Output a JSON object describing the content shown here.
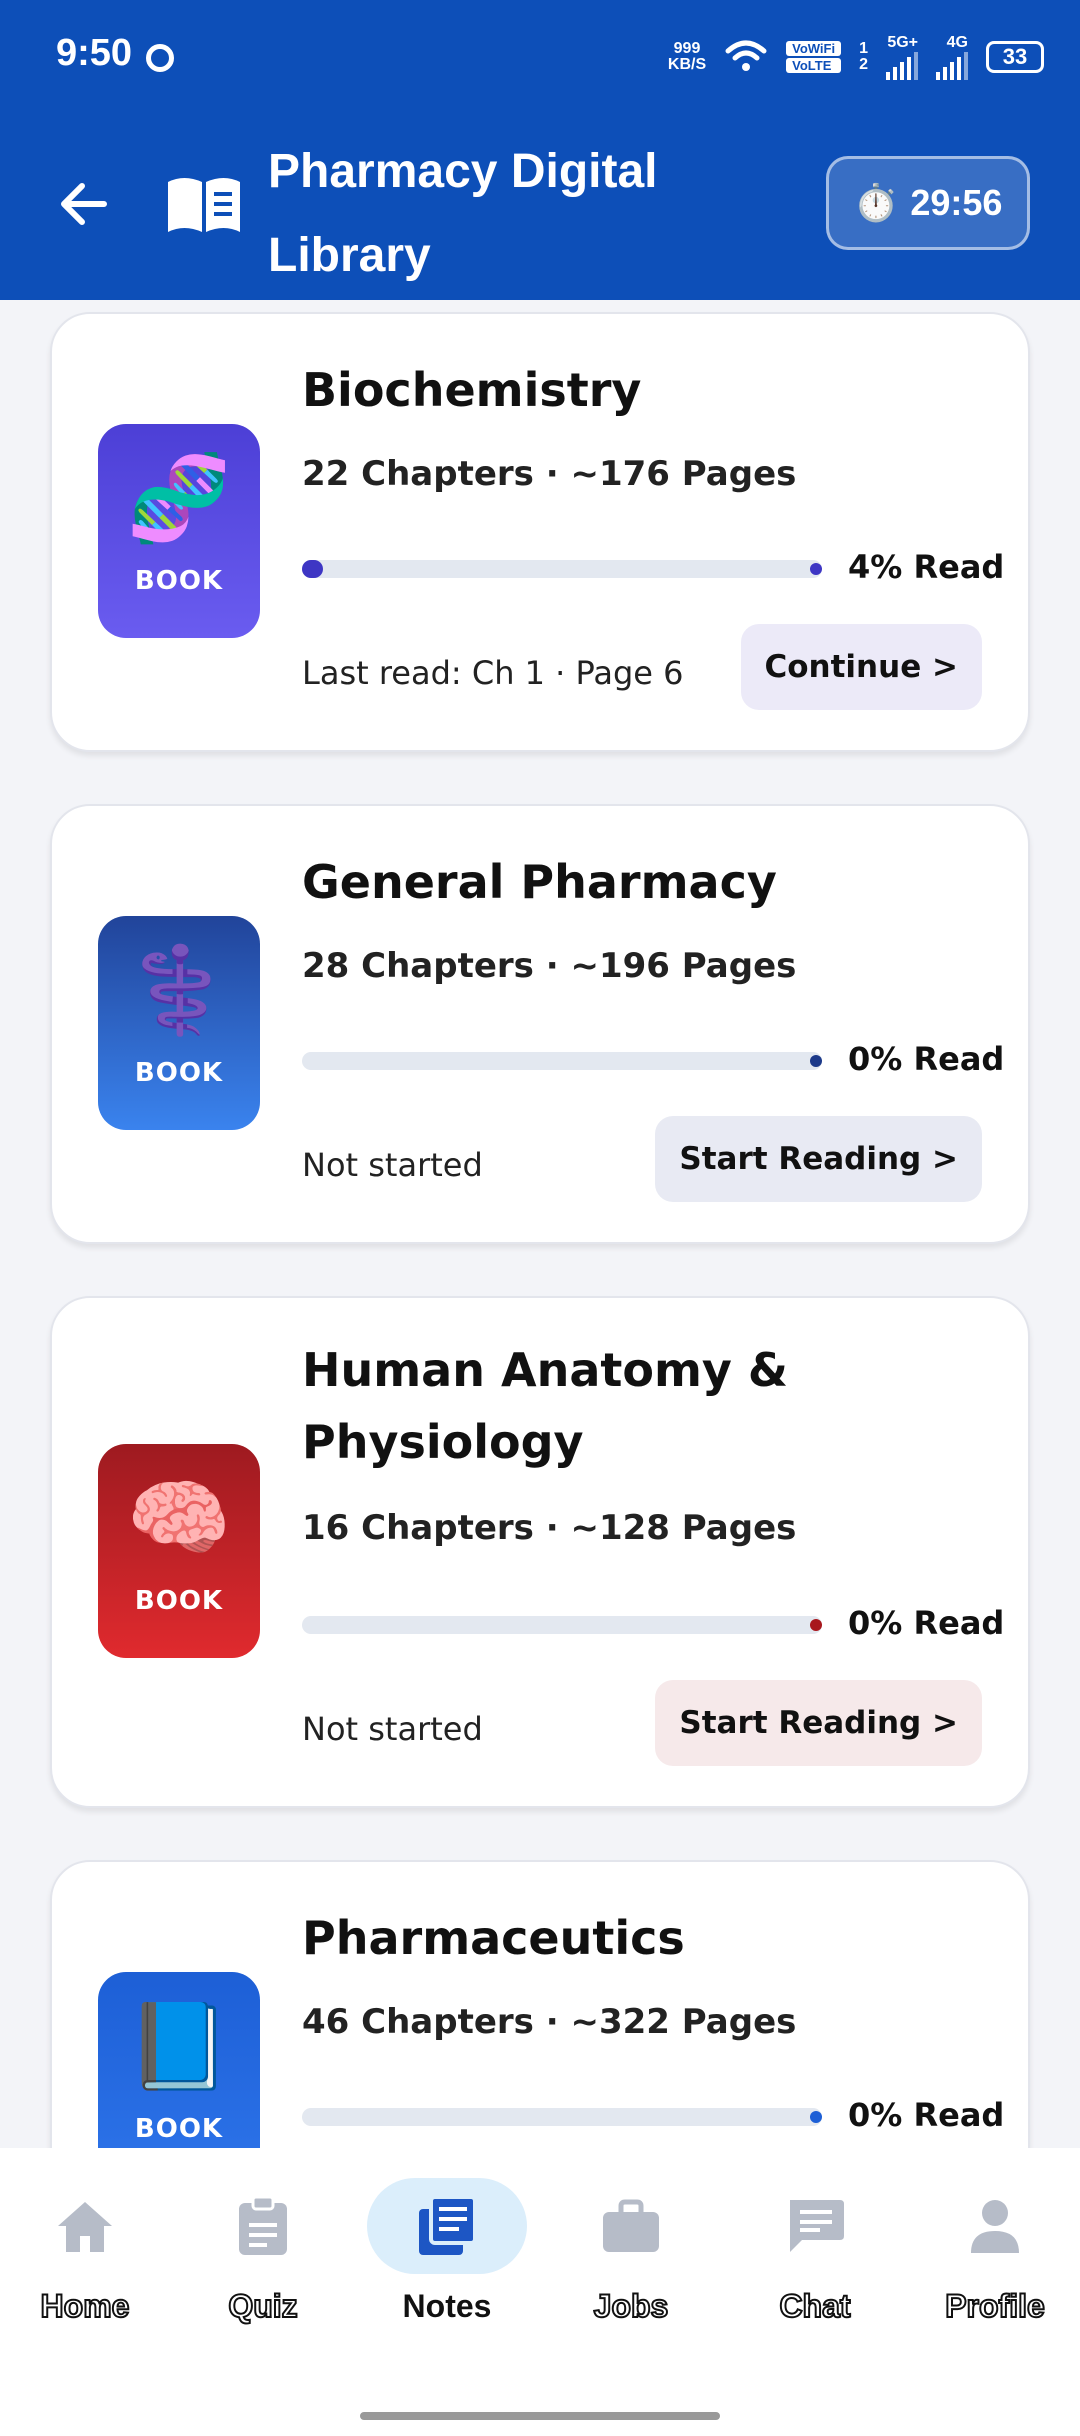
{
  "status_bar": {
    "time": "9:50",
    "data_rate_top": "999",
    "data_rate_bottom": "KB/S",
    "vowifi": "VoWiFi",
    "volte": "VoLTE",
    "sim1": "1",
    "sim2": "2",
    "net1": "5G+",
    "net2": "4G",
    "battery": "33"
  },
  "header": {
    "title": "Pharmacy Digital Library",
    "timer": "29:56",
    "timer_icon": "stopwatch-icon",
    "accent": "#0d4fb8"
  },
  "books": [
    {
      "title": "Biochemistry",
      "meta": "22 Chapters · ~176 Pages",
      "progress_percent": 4,
      "progress_label": "4% Read",
      "status": "Last read: Ch 1 · Page 6",
      "action": "Continue >",
      "cover_label": "BOOK",
      "cover_emoji": "🧬",
      "cover_colors": [
        "#4c3fd6",
        "#6a5cf0"
      ],
      "progress_color": "#3e36c4",
      "action_bg": "#eceaf8"
    },
    {
      "title": "General Pharmacy",
      "meta": "28 Chapters · ~196 Pages",
      "progress_percent": 0,
      "progress_label": "0% Read",
      "status": "Not started",
      "action": "Start Reading >",
      "cover_label": "BOOK",
      "cover_emoji": "⚕️",
      "cover_colors": [
        "#21449a",
        "#3a83ee"
      ],
      "progress_color": "#1d3a8a",
      "action_bg": "#e8eaf3"
    },
    {
      "title": "Human Anatomy & Physiology",
      "meta": "16 Chapters · ~128 Pages",
      "progress_percent": 0,
      "progress_label": "0% Read",
      "status": "Not started",
      "action": "Start Reading >",
      "cover_label": "BOOK",
      "cover_emoji": "🧠",
      "cover_colors": [
        "#9e1a20",
        "#e02a2e"
      ],
      "progress_color": "#a8171d",
      "action_bg": "#f6e9ea"
    },
    {
      "title": "Pharmaceutics",
      "meta": "46 Chapters · ~322 Pages",
      "progress_percent": 0,
      "progress_label": "0% Read",
      "cover_label": "BOOK",
      "cover_emoji": "📘",
      "cover_colors": [
        "#1d5fd6",
        "#2d74ea"
      ],
      "progress_color": "#1d5fd6"
    }
  ],
  "nav": [
    {
      "label": "Home",
      "icon": "home-icon"
    },
    {
      "label": "Quiz",
      "icon": "clipboard-icon"
    },
    {
      "label": "Notes",
      "icon": "notes-icon",
      "active": true
    },
    {
      "label": "Jobs",
      "icon": "briefcase-icon"
    },
    {
      "label": "Chat",
      "icon": "chat-icon"
    },
    {
      "label": "Profile",
      "icon": "profile-icon"
    }
  ]
}
